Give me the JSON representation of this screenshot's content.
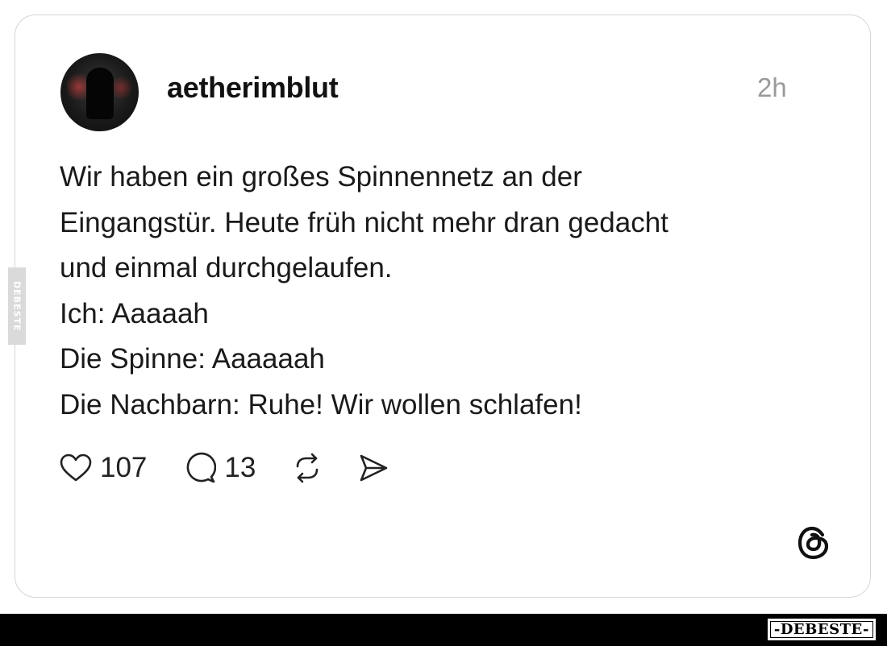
{
  "post": {
    "username": "aetherimblut",
    "timestamp": "2h",
    "avatar_icon": "profile-avatar",
    "text_lines": [
      "Wir haben ein großes Spinnennetz an der",
      "Eingangstür. Heute früh nicht mehr dran gedacht",
      "und einmal durchgelaufen.",
      "Ich: Aaaaah",
      "Die Spinne: Aaaaaah",
      "Die Nachbarn: Ruhe! Wir wollen schlafen!"
    ],
    "actions": {
      "like_count": "107",
      "comment_count": "13",
      "like_icon": "heart-icon",
      "comment_icon": "comment-bubble-icon",
      "repost_icon": "repost-icon",
      "share_icon": "send-icon"
    }
  },
  "branding": {
    "app_icon": "threads-logo-icon",
    "side_watermark": "DEBESTE",
    "bottom_watermark": "-DEBESTE-"
  },
  "colors": {
    "background": "#ffffff",
    "card_border": "#d6d6d6",
    "text": "#1a1a1a",
    "muted": "#9a9a9a",
    "footer": "#000000"
  }
}
